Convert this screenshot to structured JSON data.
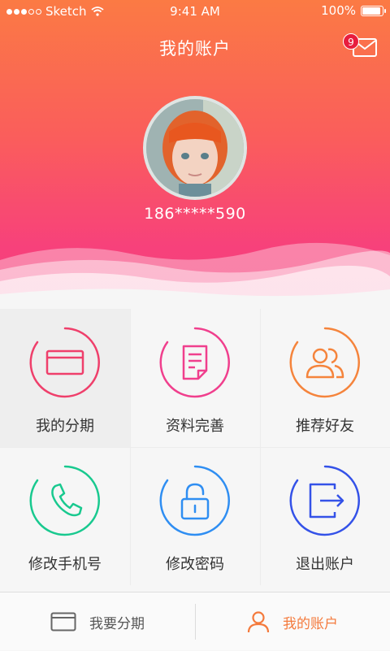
{
  "status_bar": {
    "carrier": "Sketch",
    "time": "9:41 AM",
    "battery": "100%"
  },
  "header": {
    "title": "我的账户",
    "mail_badge": "9",
    "phone": "186*****590"
  },
  "menu": [
    {
      "label": "我的分期",
      "icon": "card-icon",
      "color": "#ef3f6b"
    },
    {
      "label": "资料完善",
      "icon": "document-icon",
      "color": "#f03f8d"
    },
    {
      "label": "推荐好友",
      "icon": "friends-icon",
      "color": "#f5843c"
    },
    {
      "label": "修改手机号",
      "icon": "phone-icon",
      "color": "#19c98f"
    },
    {
      "label": "修改密码",
      "icon": "unlock-icon",
      "color": "#2f8ef2"
    },
    {
      "label": "退出账户",
      "icon": "logout-icon",
      "color": "#3452e8"
    }
  ],
  "tabs": [
    {
      "label": "我要分期",
      "icon": "card-icon",
      "active": false
    },
    {
      "label": "我的账户",
      "icon": "person-icon",
      "active": true
    }
  ],
  "colors": {
    "accent": "#f47a3c",
    "header_top": "#fb7a44",
    "header_bottom": "#f4407d"
  }
}
